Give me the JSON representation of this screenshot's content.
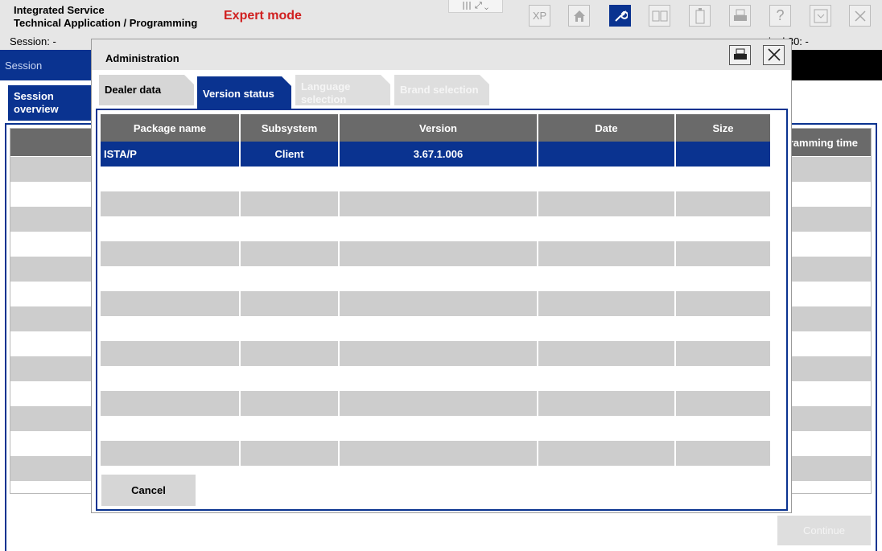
{
  "header": {
    "title_line1": "Integrated Service",
    "title_line2": "Technical Application / Programming",
    "mode": "Expert mode",
    "toolbar": {
      "xp_label": "XP",
      "home_icon": "home-icon",
      "wrench_icon": "wrench-icon",
      "active_tool": "wrench",
      "help_label": "?"
    }
  },
  "session_bar": {
    "session_label": "Session:  -",
    "terminal_label": "inal 30:  -"
  },
  "background": {
    "session_strip_label": "Session",
    "tab_label_line1": "Session",
    "tab_label_line2": "overview",
    "table_header_fragment": "ramming time",
    "continue_label": "Continue"
  },
  "dialog": {
    "title": "Administration",
    "tabs": [
      {
        "label_line1": "Dealer data",
        "label_line2": "",
        "state": "normal"
      },
      {
        "label_line1": "Version status",
        "label_line2": "",
        "state": "active"
      },
      {
        "label_line1": "Language",
        "label_line2": "selection",
        "state": "disabled"
      },
      {
        "label_line1": "Brand selection",
        "label_line2": "",
        "state": "disabled"
      }
    ],
    "table": {
      "columns": [
        "Package name",
        "Subsystem",
        "Version",
        "Date",
        "Size"
      ],
      "rows": [
        {
          "package": "ISTA/P",
          "subsystem": "Client",
          "version": "3.67.1.006",
          "date": "",
          "size": "",
          "selected": true
        }
      ]
    },
    "cancel_label": "Cancel"
  },
  "colors": {
    "accent_blue": "#0a3390",
    "header_gray": "#e6e6e6",
    "table_header": "#6a6a6a",
    "row_shade": "#cdcdcd",
    "expert_red": "#d02020"
  }
}
